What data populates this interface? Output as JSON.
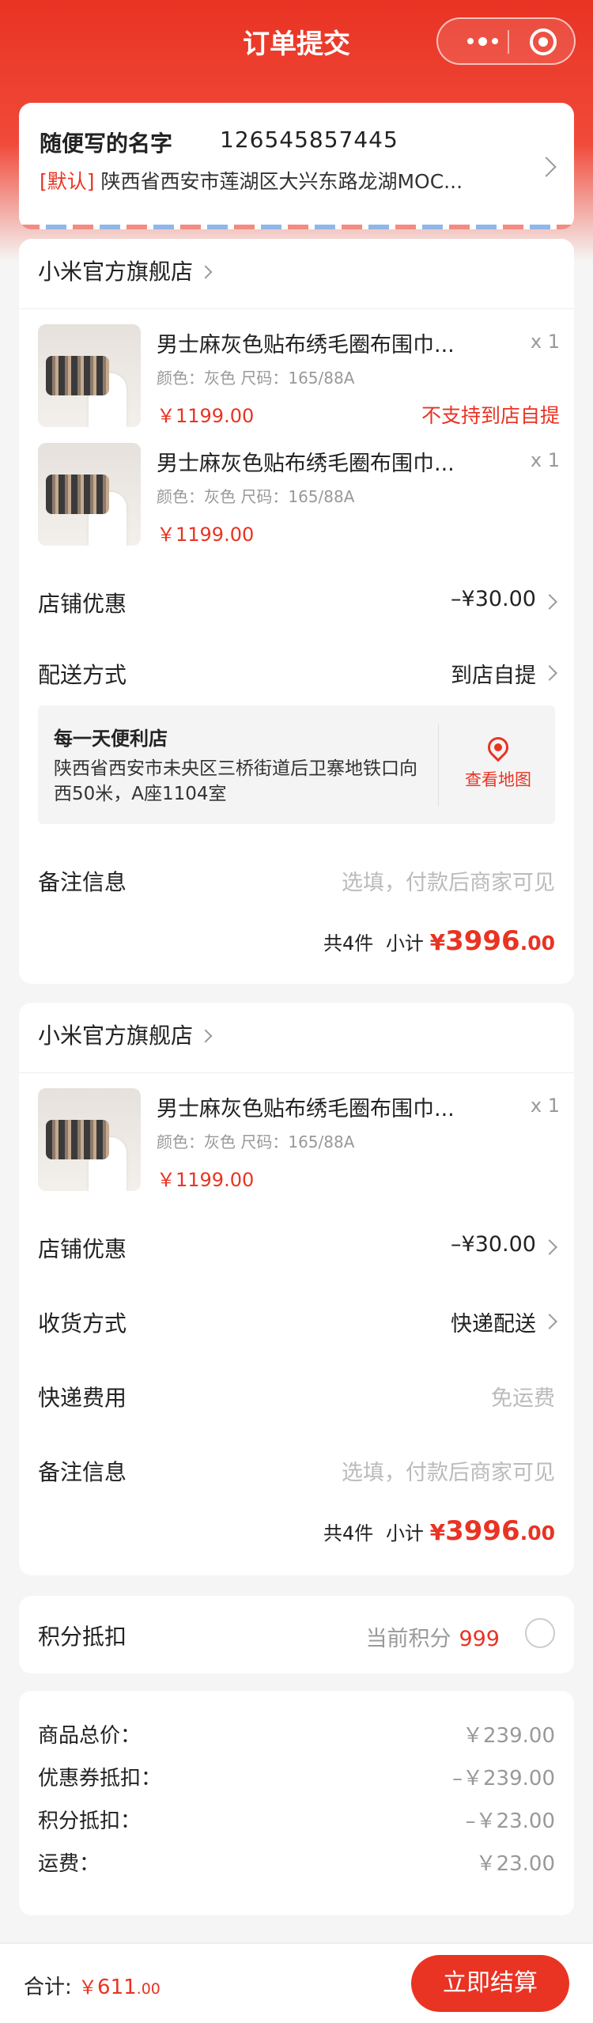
{
  "page": {
    "title": "订单提交"
  },
  "address": {
    "name": "随便写的名字",
    "phone": "126545857445",
    "tag": "[默认]",
    "detail": "陕西省西安市莲湖区大兴东路龙湖MOC..."
  },
  "stores": [
    {
      "name": "小米官方旗舰店",
      "goods": [
        {
          "name": "男士麻灰色贴布绣毛圈布围巾...",
          "qty": "x 1",
          "attr": "颜色：灰色  尺码：165/88A",
          "price": "￥1199.00",
          "notice": "不支持到店自提"
        },
        {
          "name": "男士麻灰色贴布绣毛圈布围巾...",
          "qty": "x 1",
          "attr": "颜色：灰色  尺码：165/88A",
          "price": "￥1199.00"
        }
      ],
      "discount_label": "店铺优惠",
      "discount_value": "–¥30.00",
      "delivery_label": "配送方式",
      "delivery_value": "到店自提",
      "pickup": {
        "name": "每一天便利店",
        "address": "陕西省西安市未央区三桥街道后卫寨地铁口向西50米，A座1104室",
        "map_label": "查看地图"
      },
      "remark_label": "备注信息",
      "remark_placeholder": "选填，付款后商家可见",
      "count_text": "共4件",
      "subtotal_label": "小计",
      "subtotal_currency": "¥",
      "subtotal_int": "3996",
      "subtotal_dec": ".00"
    },
    {
      "name": "小米官方旗舰店",
      "goods": [
        {
          "name": "男士麻灰色贴布绣毛圈布围巾...",
          "qty": "x 1",
          "attr": "颜色：灰色  尺码：165/88A",
          "price": "￥1199.00"
        }
      ],
      "discount_label": "店铺优惠",
      "discount_value": "–¥30.00",
      "delivery_label": "收货方式",
      "delivery_value": "快递配送",
      "shipping_label": "快递费用",
      "shipping_value": "免运费",
      "remark_label": "备注信息",
      "remark_placeholder": "选填，付款后商家可见",
      "count_text": "共4件",
      "subtotal_label": "小计",
      "subtotal_currency": "¥",
      "subtotal_int": "3996",
      "subtotal_dec": ".00"
    }
  ],
  "points": {
    "label": "积分抵扣",
    "current_label": "当前积分",
    "current_value": "999"
  },
  "summary": [
    {
      "label": "商品总价：",
      "value": "￥239.00"
    },
    {
      "label": "优惠券抵扣：",
      "value": "–￥239.00"
    },
    {
      "label": "积分抵扣：",
      "value": "–￥23.00"
    },
    {
      "label": "运费：",
      "value": "￥23.00"
    }
  ],
  "footer": {
    "total_label": "合计:",
    "currency": "￥",
    "total_int": "611",
    "total_dec": ".00",
    "pay_label": "立即结算"
  },
  "colors": {
    "accent": "#e93323",
    "background": "#f5f5f5"
  }
}
